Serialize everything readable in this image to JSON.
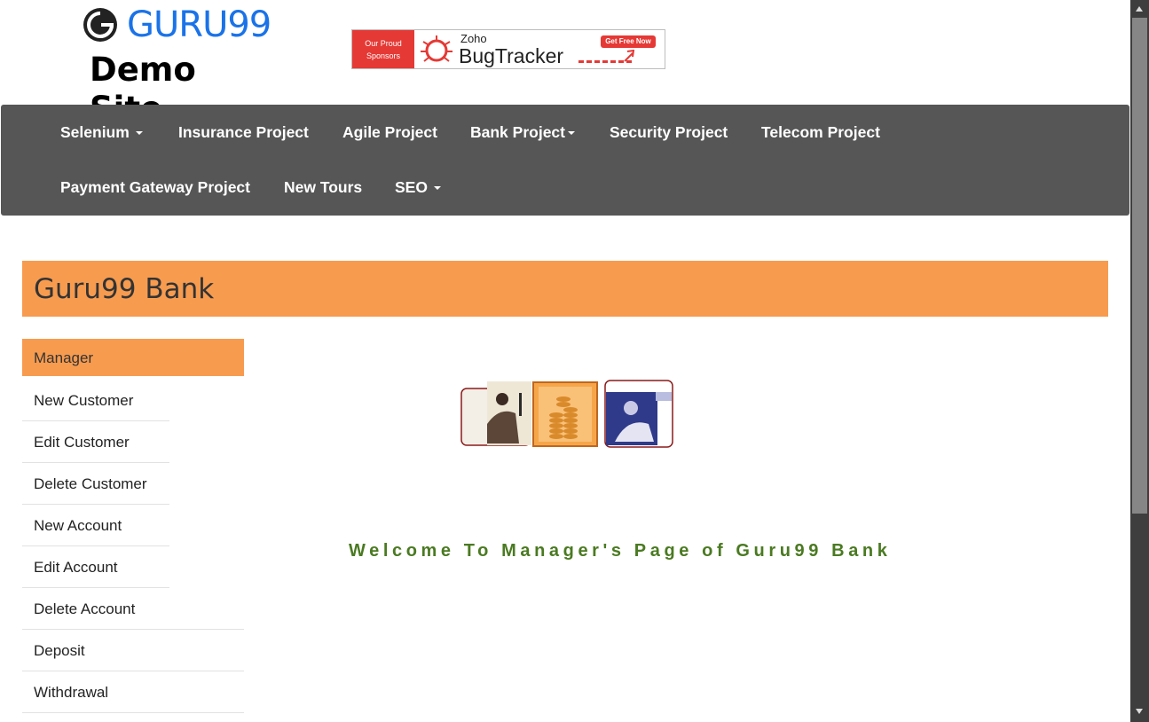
{
  "header": {
    "logo_text": "GURU99",
    "site_subtitle": "Demo Site",
    "sponsor": {
      "left_text_line1": "Our Proud",
      "left_text_line2": "Sponsors",
      "brand_small": "Zoho",
      "brand_large": "BugTracker",
      "cta": "Get Free Now"
    }
  },
  "nav": {
    "items": [
      {
        "label": "Selenium",
        "dropdown": true
      },
      {
        "label": "Insurance Project",
        "dropdown": false
      },
      {
        "label": "Agile Project",
        "dropdown": false
      },
      {
        "label": "Bank Project",
        "dropdown": true
      },
      {
        "label": "Security Project",
        "dropdown": false
      },
      {
        "label": "Telecom Project",
        "dropdown": false
      },
      {
        "label": "Payment Gateway Project",
        "dropdown": false
      },
      {
        "label": "New Tours",
        "dropdown": false
      },
      {
        "label": "SEO",
        "dropdown": true
      }
    ]
  },
  "bank": {
    "title": "Guru99 Bank"
  },
  "sidebar": {
    "active": "Manager",
    "items": [
      {
        "label": "New Customer"
      },
      {
        "label": "Edit Customer"
      },
      {
        "label": "Delete Customer"
      },
      {
        "label": "New Account"
      },
      {
        "label": "Edit Account"
      },
      {
        "label": "Delete Account"
      },
      {
        "label": "Deposit"
      },
      {
        "label": "Withdrawal"
      }
    ]
  },
  "main": {
    "welcome": "Welcome To Manager's Page of Guru99 Bank"
  },
  "colors": {
    "accent_orange": "#f79b4f",
    "nav_bg": "#565656",
    "welcome_green": "#4a7a21",
    "logo_blue": "#1a73e8"
  }
}
